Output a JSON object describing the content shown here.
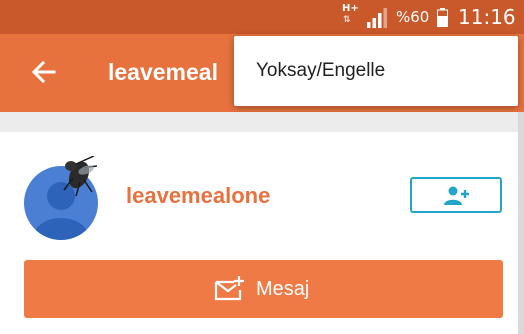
{
  "status_bar": {
    "network_type": "H+",
    "battery_text": "%60",
    "time": "11:16"
  },
  "app_bar": {
    "title": "leavemeal"
  },
  "menu": {
    "items": [
      {
        "label": "Yoksay/Engelle"
      }
    ]
  },
  "profile": {
    "username": "leavemealone",
    "message_label": "Mesaj"
  },
  "colors": {
    "status_bar": "#c9582a",
    "app_bar": "#e8723e",
    "accent_orange": "#f07a45",
    "username_orange": "#e8723e",
    "add_friend_border": "#21a6c9",
    "avatar_blue": "#4a7fd4"
  },
  "icons": {
    "back": "arrow-left-icon",
    "add_friend": "person-add-icon",
    "message": "mail-add-icon",
    "signal": "signal-icon",
    "battery": "battery-icon",
    "avatar_overlay": "fly-icon"
  }
}
